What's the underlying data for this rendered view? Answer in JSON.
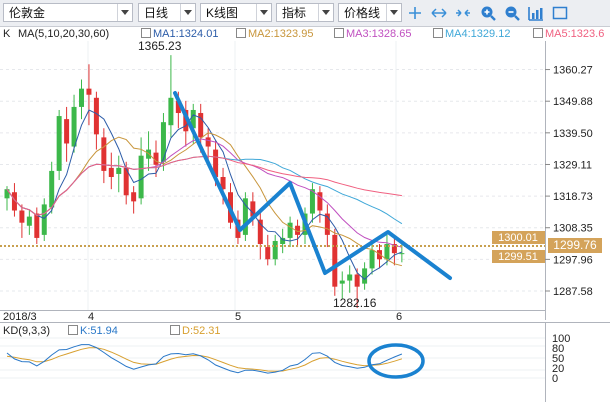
{
  "toolbar": {
    "symbol": "伦敦金",
    "period": "日线",
    "chart_type": "K线图",
    "indicator": "指标",
    "price_line": "价格线",
    "icons": [
      "crosshair-icon",
      "arrows-horizontal-icon",
      "arrows-collapse-icon",
      "zoom-in-icon",
      "zoom-out-icon",
      "grid-icon",
      "rectangle-icon"
    ]
  },
  "legend": {
    "k_label": "K",
    "ma_params": "MA(5,10,20,30,60)",
    "ma1": "MA1:1324.01",
    "ma2": "MA2:1323.95",
    "ma3": "MA3:1328.65",
    "ma4": "MA4:1329.12",
    "ma5": "MA5:1323.6",
    "ma1_color": "#2c5ca8",
    "ma2_color": "#c8963c",
    "ma3_color": "#c050c0",
    "ma4_color": "#40a8d8",
    "ma5_color": "#f06080"
  },
  "price_axis": {
    "ticks": [
      "1360.27",
      "1349.88",
      "1339.50",
      "1329.11",
      "1318.73",
      "1308.35",
      "1297.96",
      "1287.58"
    ],
    "current_price": "1300.01",
    "bid_price": "1299.76",
    "ask_price": "1299.51"
  },
  "annotations": {
    "high": "1365.23",
    "low": "1282.16"
  },
  "time_axis": {
    "labels": [
      "2018/3",
      "4",
      "5",
      "6"
    ]
  },
  "kd": {
    "params": "KD(9,3,3)",
    "k_value": "K:51.94",
    "d_value": "D:52.31",
    "k_color": "#2a78c8",
    "d_color": "#d8a030",
    "ticks": [
      "100",
      "80",
      "50",
      "20",
      "0"
    ]
  },
  "colors": {
    "up": "#3cb84a",
    "down": "#e03232",
    "drawing": "#1a82d0"
  },
  "chart_data": {
    "type": "candlestick",
    "x_labels": [
      "2018/3",
      "4",
      "5",
      "6"
    ],
    "ylim": [
      1282,
      1368
    ],
    "candles": [
      [
        1318,
        1321,
        1314,
        1322
      ],
      [
        1320,
        1314,
        1312,
        1323
      ],
      [
        1314,
        1310,
        1305,
        1316
      ],
      [
        1309,
        1312,
        1306,
        1314
      ],
      [
        1313,
        1305,
        1303,
        1315
      ],
      [
        1306,
        1316,
        1304,
        1318
      ],
      [
        1315,
        1327,
        1313,
        1330
      ],
      [
        1327,
        1345,
        1324,
        1347
      ],
      [
        1344,
        1336,
        1330,
        1348
      ],
      [
        1335,
        1348,
        1333,
        1352
      ],
      [
        1348,
        1354,
        1344,
        1357
      ],
      [
        1354,
        1352,
        1342,
        1362
      ],
      [
        1351,
        1339,
        1334,
        1353
      ],
      [
        1338,
        1327,
        1323,
        1341
      ],
      [
        1328,
        1325,
        1321,
        1333
      ],
      [
        1326,
        1328,
        1320,
        1332
      ],
      [
        1328,
        1319,
        1316,
        1330
      ],
      [
        1320,
        1317,
        1313,
        1322
      ],
      [
        1318,
        1332,
        1316,
        1338
      ],
      [
        1331,
        1334,
        1327,
        1340
      ],
      [
        1333,
        1329,
        1325,
        1337
      ],
      [
        1330,
        1343,
        1327,
        1346
      ],
      [
        1342,
        1351,
        1338,
        1365
      ],
      [
        1350,
        1346,
        1341,
        1353
      ],
      [
        1347,
        1340,
        1335,
        1350
      ],
      [
        1341,
        1347,
        1336,
        1349
      ],
      [
        1346,
        1338,
        1333,
        1349
      ],
      [
        1338,
        1335,
        1330,
        1341
      ],
      [
        1334,
        1325,
        1322,
        1337
      ],
      [
        1325,
        1321,
        1316,
        1328
      ],
      [
        1320,
        1310,
        1308,
        1323
      ],
      [
        1311,
        1305,
        1303,
        1314
      ],
      [
        1306,
        1318,
        1304,
        1320
      ],
      [
        1317,
        1312,
        1309,
        1320
      ],
      [
        1311,
        1303,
        1298,
        1314
      ],
      [
        1302,
        1298,
        1296,
        1306
      ],
      [
        1298,
        1304,
        1296,
        1306
      ],
      [
        1303,
        1305,
        1300,
        1308
      ],
      [
        1305,
        1310,
        1302,
        1312
      ],
      [
        1309,
        1306,
        1302,
        1311
      ],
      [
        1306,
        1313,
        1303,
        1315
      ],
      [
        1313,
        1321,
        1310,
        1323
      ],
      [
        1320,
        1314,
        1310,
        1322
      ],
      [
        1313,
        1306,
        1302,
        1316
      ],
      [
        1306,
        1289,
        1286,
        1308
      ],
      [
        1290,
        1291,
        1285,
        1294
      ],
      [
        1291,
        1293,
        1287,
        1296
      ],
      [
        1293,
        1289,
        1282,
        1295
      ],
      [
        1290,
        1295,
        1288,
        1297
      ],
      [
        1295,
        1301,
        1293,
        1304
      ],
      [
        1301,
        1298,
        1295,
        1303
      ],
      [
        1298,
        1303,
        1296,
        1306
      ],
      [
        1303,
        1300,
        1296,
        1305
      ],
      [
        1300,
        1300,
        1297,
        1303
      ]
    ]
  }
}
